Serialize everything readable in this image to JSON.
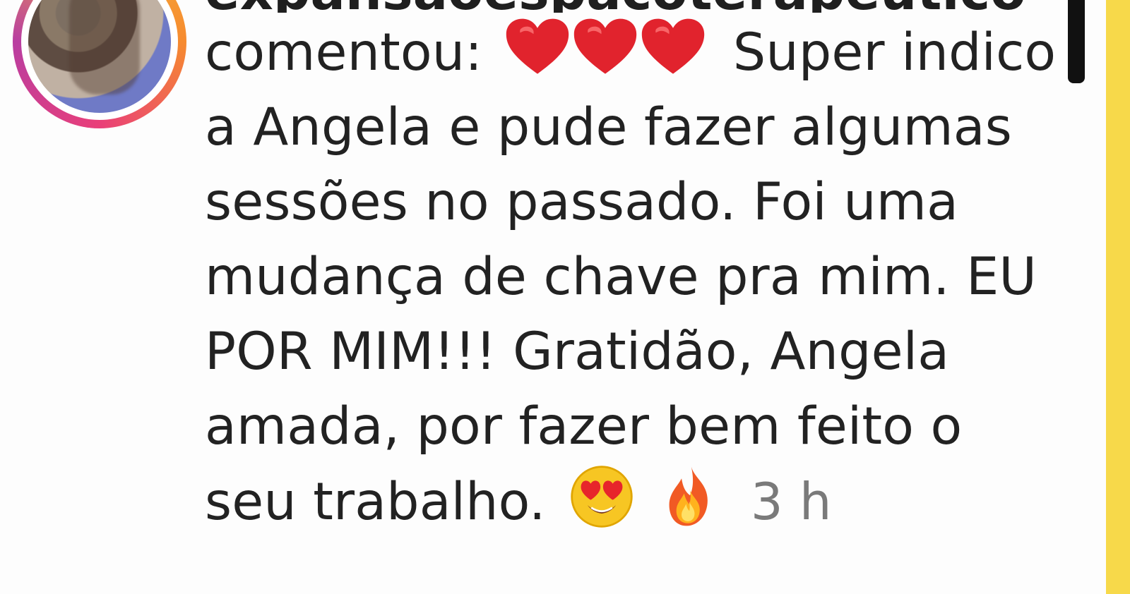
{
  "username": "expansaoespacoterapeutico",
  "comment": {
    "lead": "comentou:",
    "line1_after_emoji": "Super indico",
    "line2": "a Angela e pude fazer algumas",
    "line3": "sessões no passado. Foi uma",
    "line4": "mudança de chave pra mim. EU",
    "line5": "POR MIM!!! Gratidão, Angela",
    "line6": "amada, por fazer bem feito o",
    "line7": "seu trabalho."
  },
  "timestamp": "3 h",
  "icons": {
    "hearts": [
      "heart-icon",
      "heart-icon",
      "heart-icon"
    ],
    "face": "heart-eyes-face-icon",
    "fire": "fire-icon"
  },
  "colors": {
    "background": "#fdfdfd",
    "frame": "#f7d94a",
    "text": "#222222",
    "muted": "#7a7a7a",
    "heart": "#e1232d",
    "fire": "#f15a24"
  }
}
